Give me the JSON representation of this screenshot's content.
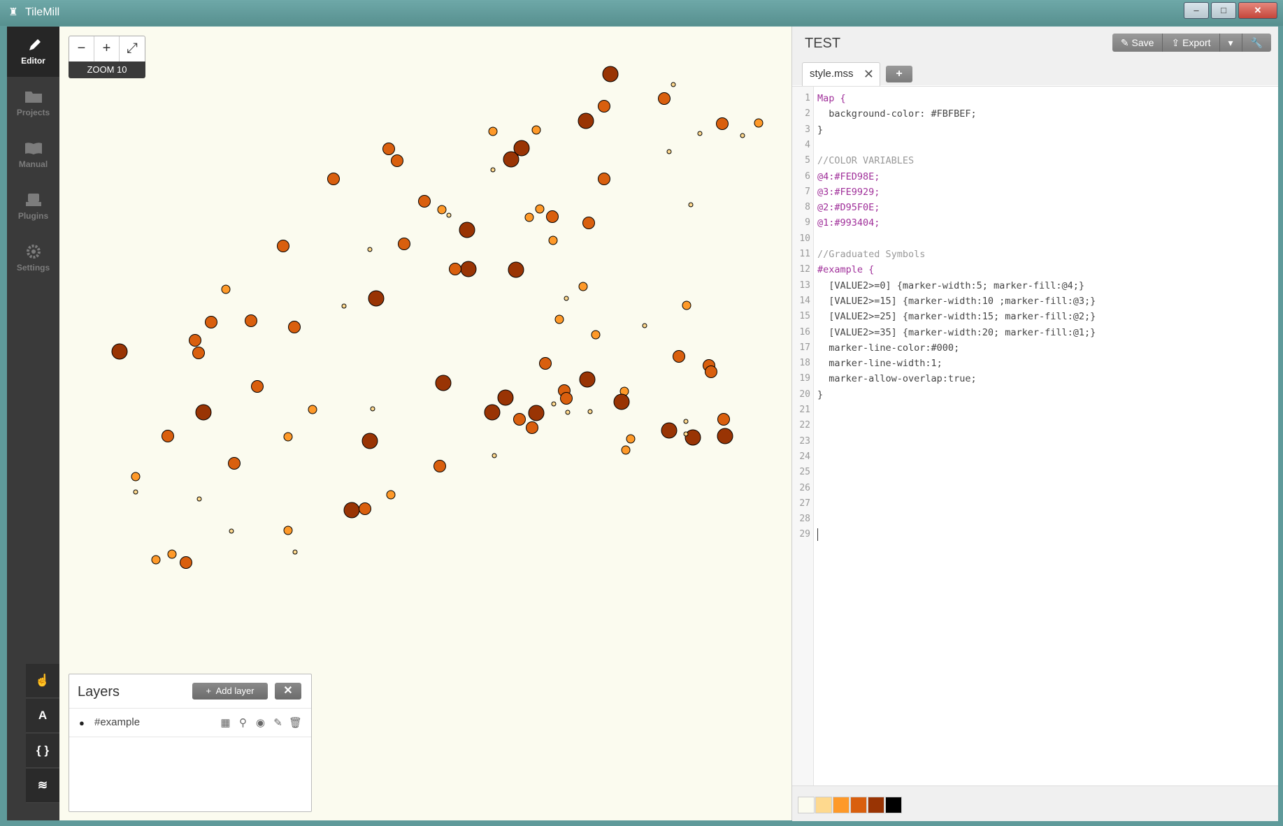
{
  "window": {
    "title": "TileMill",
    "controls": {
      "minimize": "–",
      "maximize": "□",
      "close": "✕"
    },
    "colors": {
      "titlebar": "#5f9a9a"
    }
  },
  "sidebar": {
    "items": [
      {
        "label": "Editor",
        "icon": "pencil-icon",
        "active": true
      },
      {
        "label": "Projects",
        "icon": "folder-icon",
        "active": false
      },
      {
        "label": "Manual",
        "icon": "book-icon",
        "active": false
      },
      {
        "label": "Plugins",
        "icon": "plugin-icon",
        "active": false
      },
      {
        "label": "Settings",
        "icon": "gear-icon",
        "active": false
      }
    ],
    "tools": [
      {
        "icon": "hand-pointer-icon",
        "glyph": "☝"
      },
      {
        "icon": "font-icon",
        "glyph": "A"
      },
      {
        "icon": "braces-icon",
        "glyph": "{ }"
      },
      {
        "icon": "layers-icon",
        "glyph": "≋"
      }
    ]
  },
  "map": {
    "zoom_label": "ZOOM 10",
    "zoom_out": "−",
    "zoom_in": "+",
    "fullscreen": "⤢",
    "background": "#FBFBEF"
  },
  "layers": {
    "title": "Layers",
    "add_layer_label": "Add layer",
    "items": [
      {
        "name": "#example"
      }
    ]
  },
  "editor": {
    "project_title": "TEST",
    "buttons": {
      "save": "Save",
      "export": "Export"
    },
    "tab_name": "style.mss",
    "add_tab": "+",
    "code_lines": [
      "Map {",
      "  background-color: #FBFBEF;",
      "}",
      "",
      "//COLOR VARIABLES",
      "@4:#FED98E;",
      "@3:#FE9929;",
      "@2:#D95F0E;",
      "@1:#993404;",
      "",
      "//Graduated Symbols",
      "#example {",
      "  [VALUE2>=0] {marker-width:5; marker-fill:@4;}",
      "  [VALUE2>=15] {marker-width:10 ;marker-fill:@3;}",
      "  [VALUE2>=25] {marker-width:15; marker-fill:@2;}",
      "  [VALUE2>=35] {marker-width:20; marker-fill:@1;}",
      "  marker-line-color:#000;",
      "  marker-line-width:1;",
      "  marker-allow-overlap:true;",
      "}",
      "",
      "",
      "",
      "",
      "",
      "",
      "",
      "",
      ""
    ],
    "palette": [
      "#FBFBEF",
      "#FED98E",
      "#FE9929",
      "#D95F0E",
      "#993404",
      "#000000"
    ]
  }
}
